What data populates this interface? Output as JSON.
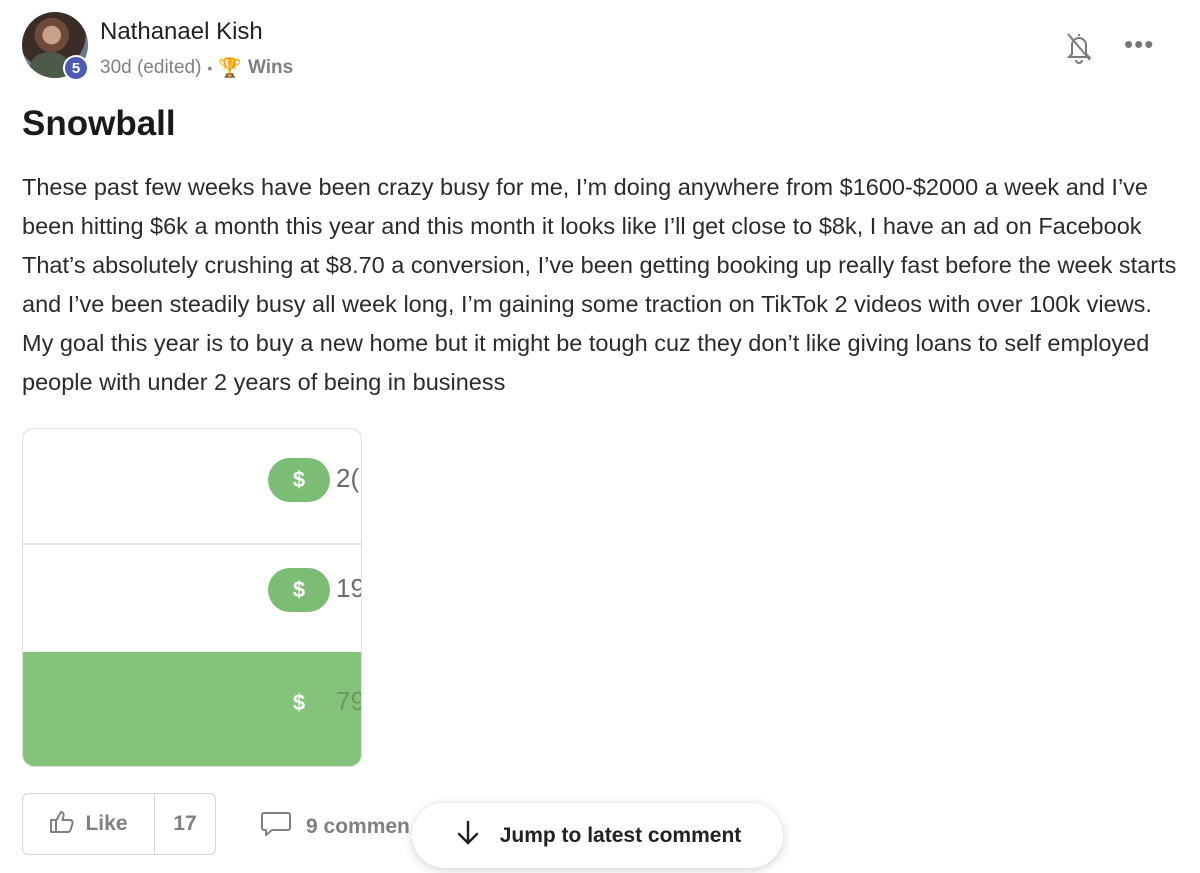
{
  "post": {
    "author": {
      "name": "Nathanael Kish",
      "level": "5",
      "avatar_icon": "user-avatar"
    },
    "timestamp": "30d (edited)",
    "separator": "•",
    "category": {
      "icon": "trophy-icon",
      "label": "Wins"
    },
    "title": "Snowball",
    "body": "These past few weeks have been crazy busy for me, I’m doing anywhere from $1600-$2000 a week and I’ve been hitting $6k a month this year and this month it looks like I’ll get close to $8k, I have an ad on Facebook That’s absolutely crushing at $8.70 a conversion, I’ve been getting booking up really fast before the week starts and I’ve been steadily busy all week long, I’m gaining some traction on TikTok 2 videos with over 100k views. My goal this year is to buy a new home but it might be tough cuz they don’t like giving loans to self employed people with under 2 years of being in business",
    "attachment": {
      "rows": [
        {
          "symbol": "$",
          "amount": "2("
        },
        {
          "symbol": "$",
          "amount": "19"
        },
        {
          "symbol": "$",
          "amount": "79"
        }
      ]
    }
  },
  "actions": {
    "like_label": "Like",
    "like_count": "17",
    "comments_label": "9 commen",
    "jump_label": "Jump to latest comment"
  },
  "colors": {
    "accent_green": "#7cbd75",
    "level_badge": "#4a5ab5",
    "muted_text": "#808080"
  }
}
